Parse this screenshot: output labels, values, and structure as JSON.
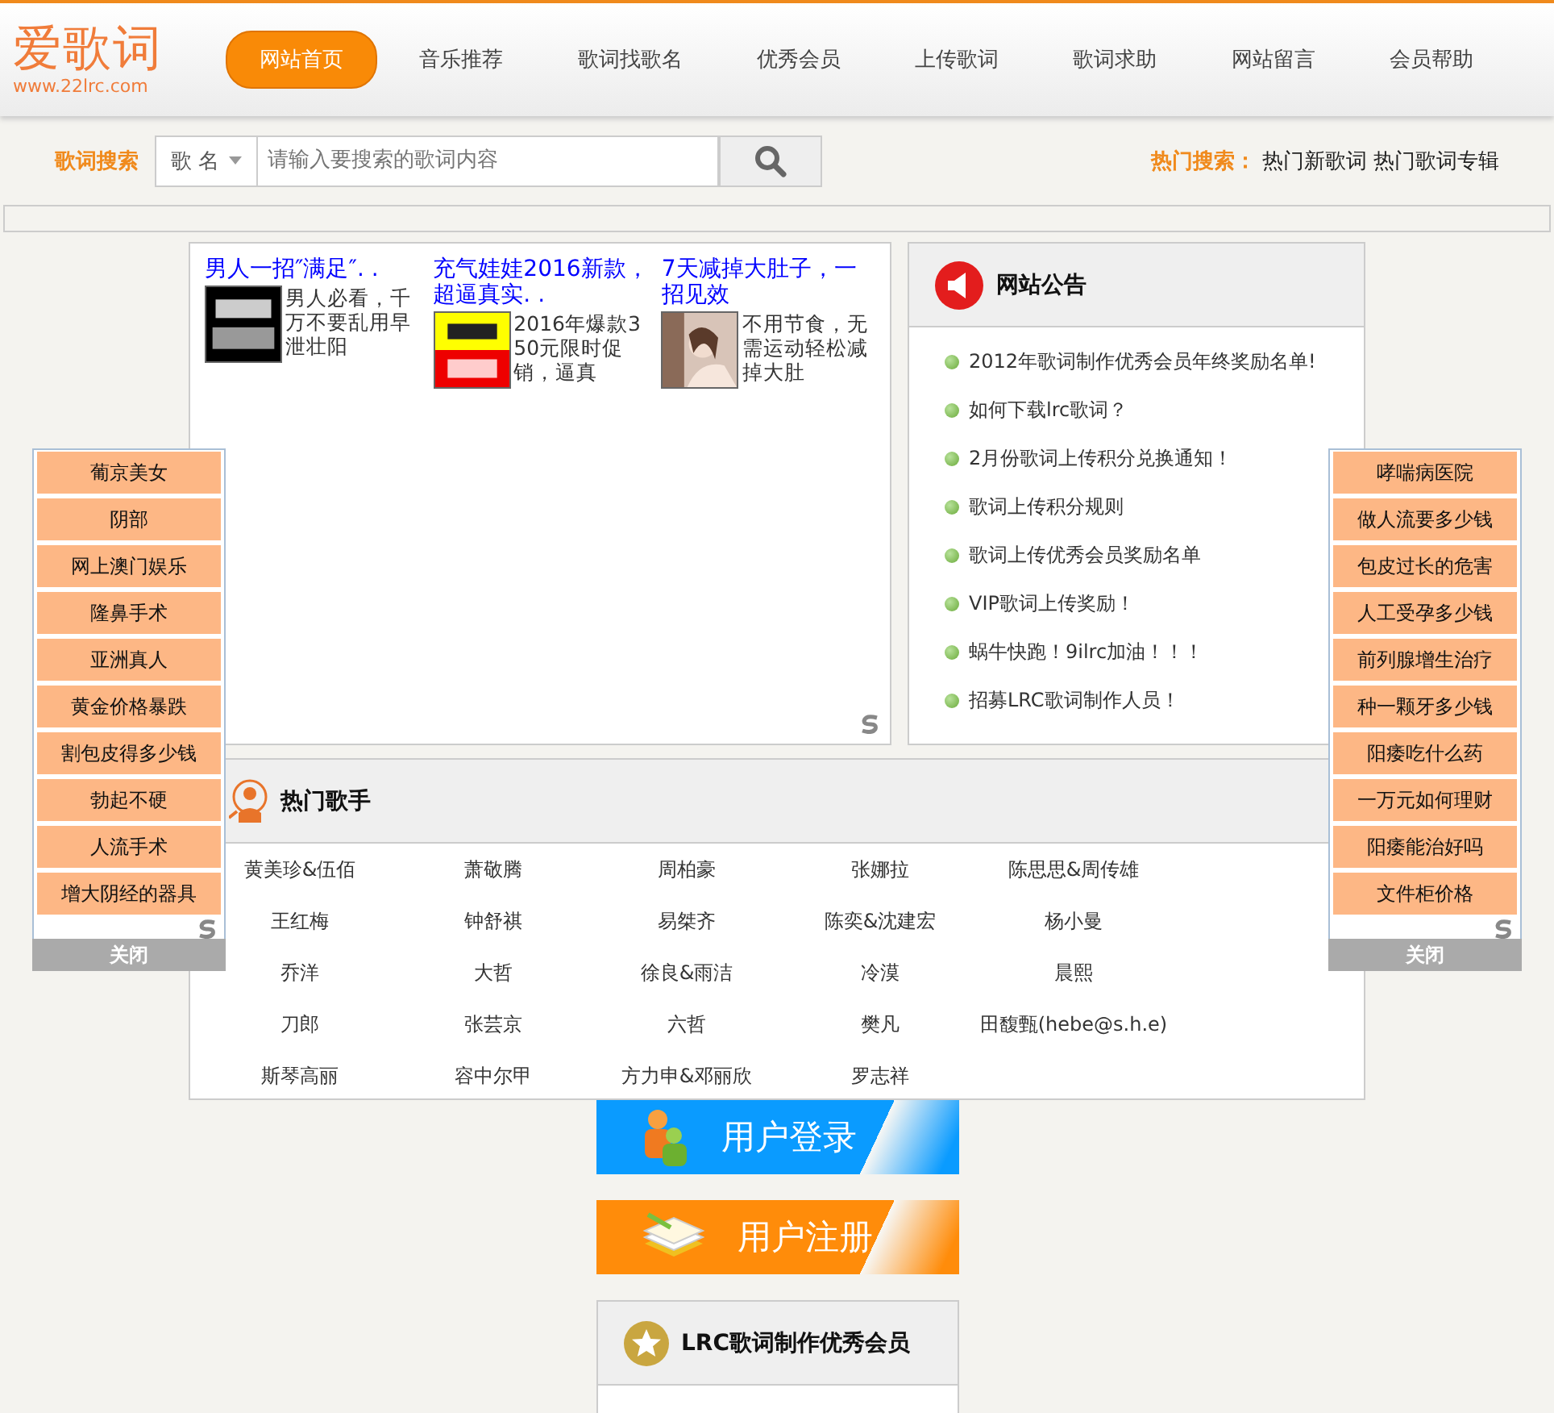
{
  "logo": {
    "name": "爱歌词",
    "url": "www.22lrc.com"
  },
  "nav": [
    {
      "label": "网站首页",
      "selected": true
    },
    {
      "label": "音乐推荐",
      "selected": false
    },
    {
      "label": "歌词找歌名",
      "selected": false
    },
    {
      "label": "优秀会员",
      "selected": false
    },
    {
      "label": "上传歌词",
      "selected": false
    },
    {
      "label": "歌词求助",
      "selected": false
    },
    {
      "label": "网站留言",
      "selected": false
    },
    {
      "label": "会员帮助",
      "selected": false
    }
  ],
  "search": {
    "label": "歌词搜索",
    "type_select": "歌 名",
    "placeholder": "请输入要搜索的歌词内容",
    "hot_label": "热门搜索：",
    "hot_links": [
      "热门新歌词",
      "热门歌词专辑"
    ]
  },
  "ads": [
    {
      "title": "男人一招″满足″. .",
      "text": "男人必看，千万不要乱用早泄壮阳"
    },
    {
      "title": "充气娃娃2016新款，超逼真实. .",
      "text": "2016年爆款350元限时促销，逼真"
    },
    {
      "title": "7天减掉大肚子，一招见效",
      "text": "不用节食，无需运动轻松减掉大肚"
    }
  ],
  "notice": {
    "title": "网站公告",
    "items": [
      "2012年歌词制作优秀会员年终奖励名单!",
      "如何下载lrc歌词？",
      "2月份歌词上传积分兑换通知！",
      "歌词上传积分规则",
      "歌词上传优秀会员奖励名单",
      "VIP歌词上传奖励！",
      "蜗牛快跑！9ilrc加油！！！",
      "招募LRC歌词制作人员！"
    ]
  },
  "side_left": {
    "items": [
      "葡京美女",
      "阴部",
      "网上澳门娱乐",
      "隆鼻手术",
      "亚洲真人",
      "黄金价格暴跌",
      "割包皮得多少钱",
      "勃起不硬",
      "人流手术",
      "增大阴经的器具"
    ],
    "close": "关闭"
  },
  "side_right": {
    "items": [
      "哮喘病医院",
      "做人流要多少钱",
      "包皮过长的危害",
      "人工受孕多少钱",
      "前列腺增生治疗",
      "种一颗牙多少钱",
      "阳痿吃什么药",
      "一万元如何理财",
      "阳痿能治好吗",
      "文件柜价格"
    ],
    "close": "关闭"
  },
  "singers": {
    "title": "热门歌手",
    "names": [
      "黄美珍&伍佰",
      "萧敬腾",
      "周柏豪",
      "张娜拉",
      "陈思思&周传雄",
      "王红梅",
      "钟舒祺",
      "易桀齐",
      "陈奕&沈建宏",
      "杨小曼",
      "乔洋",
      "大哲",
      "徐良&雨洁",
      "冷漠",
      "晨熙",
      "刀郎",
      "张芸京",
      "六哲",
      "樊凡",
      "田馥甄(hebe@s.h.e)",
      "斯琴高丽",
      "容中尔甲",
      "方力申&邓丽欣",
      "罗志祥"
    ]
  },
  "login": "用户登录",
  "register": "用户注册",
  "members": {
    "title": "LRC歌词制作优秀会员"
  }
}
